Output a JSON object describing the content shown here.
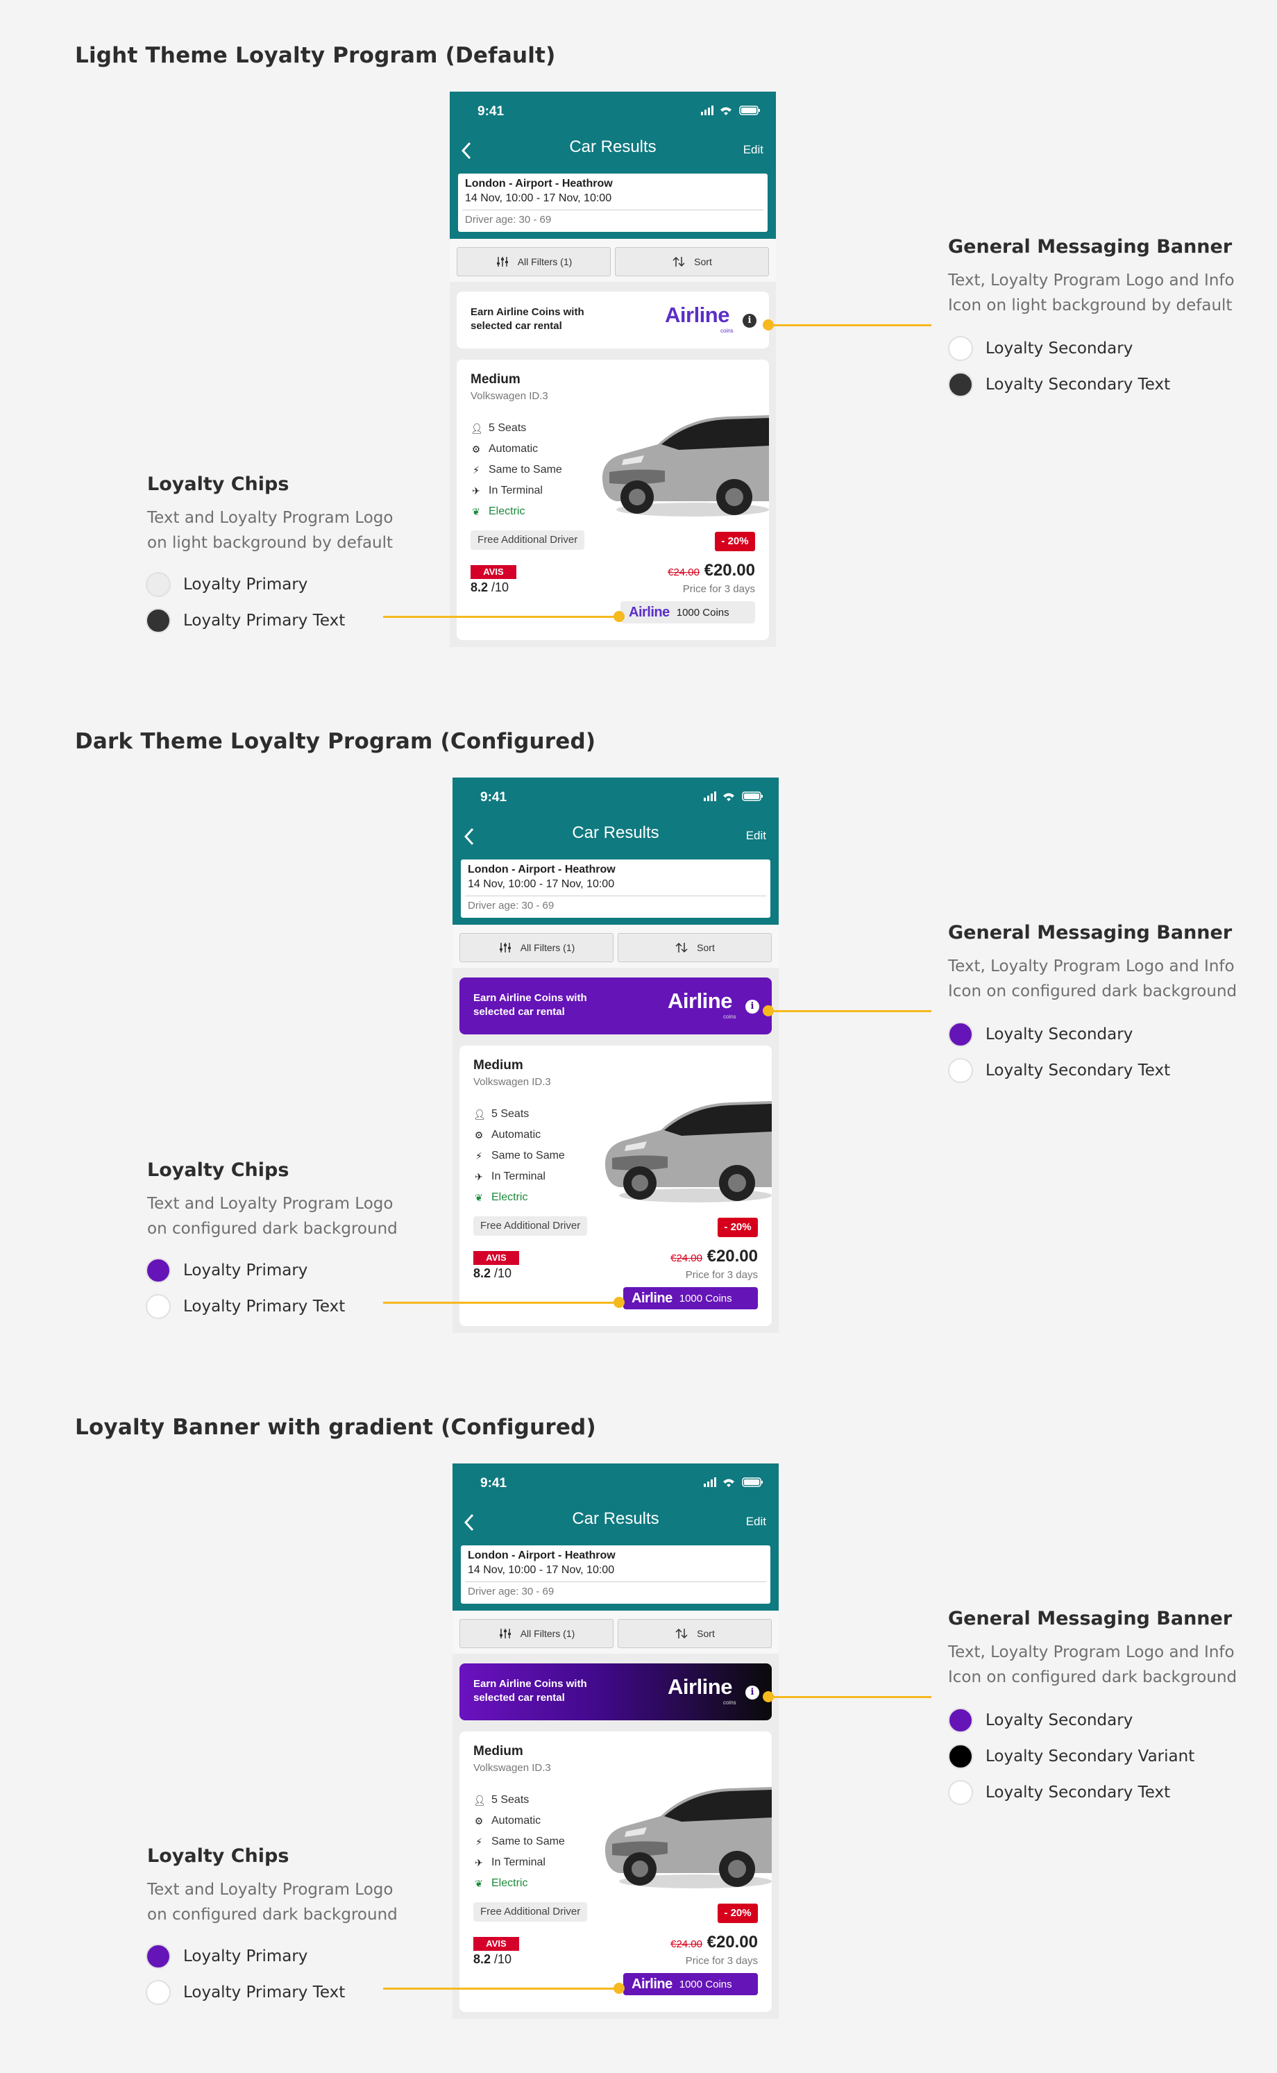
{
  "phone_common": {
    "time": "9:41",
    "nav_title": "Car Results",
    "nav_edit": "Edit",
    "search_route": "London - Airport - Heathrow",
    "search_dates": "14 Nov, 10:00 - 17 Nov, 10:00",
    "search_driver": "Driver age: 30 - 69",
    "filters_label": "All Filters (1)",
    "sort_label": "Sort",
    "banner_text": "Earn Airline Coins with selected car rental",
    "logo_text": "Airline",
    "logo_sub": "coins",
    "info_icon": "i",
    "car_class": "Medium",
    "car_model": "Volkswagen ID.3",
    "features": [
      "5 Seats",
      "Automatic",
      "Same to Same",
      "In Terminal",
      "Electric"
    ],
    "driver_chip": "Free Additional Driver",
    "discount": "- 20%",
    "supplier": "AVIS",
    "rating_value": "8.2",
    "rating_max": " /10",
    "old_price": "€24.00",
    "new_price": "€20.00",
    "price_note": "Price for 3 days",
    "coins": "1000 Coins"
  },
  "sections": [
    {
      "title": "Light Theme Loyalty Program (Default)",
      "banner": {
        "title": "General Messaging Banner",
        "desc_line1": "Text, Loyalty Program Logo and Info",
        "desc_line2": "Icon on light background by default",
        "swatches": [
          {
            "label": "Loyalty Secondary",
            "color": "#ffffff"
          },
          {
            "label": "Loyalty Secondary Text",
            "color": "#333333"
          }
        ]
      },
      "chips": {
        "title": "Loyalty Chips",
        "desc_line1": "Text and Loyalty Program Logo",
        "desc_line2": "on light background by default",
        "swatches": [
          {
            "label": "Loyalty Primary",
            "color": "#ececec"
          },
          {
            "label": "Loyalty Primary Text",
            "color": "#333333"
          }
        ]
      }
    },
    {
      "title": "Dark Theme Loyalty Program (Configured)",
      "banner": {
        "title": "General Messaging Banner",
        "desc_line1": "Text, Loyalty Program Logo and Info",
        "desc_line2": "Icon on configured dark background",
        "swatches": [
          {
            "label": "Loyalty Secondary",
            "color": "#6514b8"
          },
          {
            "label": "Loyalty Secondary Text",
            "color": "#ffffff"
          }
        ]
      },
      "chips": {
        "title": "Loyalty Chips",
        "desc_line1": "Text and Loyalty Program Logo",
        "desc_line2": "on configured dark background",
        "swatches": [
          {
            "label": "Loyalty Primary",
            "color": "#6514b8"
          },
          {
            "label": "Loyalty Primary Text",
            "color": "#ffffff"
          }
        ]
      }
    },
    {
      "title": "Loyalty Banner with gradient (Configured)",
      "banner": {
        "title": "General Messaging Banner",
        "desc_line1": "Text, Loyalty Program Logo and Info",
        "desc_line2": "Icon on configured dark background",
        "swatches": [
          {
            "label": "Loyalty Secondary",
            "color": "#6514b8"
          },
          {
            "label": "Loyalty Secondary Variant",
            "color": "#000000"
          },
          {
            "label": "Loyalty Secondary Text",
            "color": "#ffffff"
          }
        ]
      },
      "chips": {
        "title": "Loyalty Chips",
        "desc_line1": "Text and Loyalty Program Logo",
        "desc_line2": "on configured dark background",
        "swatches": [
          {
            "label": "Loyalty Primary",
            "color": "#6514b8"
          },
          {
            "label": "Loyalty Primary Text",
            "color": "#ffffff"
          }
        ]
      }
    }
  ],
  "colors": {
    "header_teal": "#0f7a80",
    "loyalty_purple": "#6514b8",
    "connector_yellow": "#f6b91e",
    "discount_red": "#d6001c"
  }
}
